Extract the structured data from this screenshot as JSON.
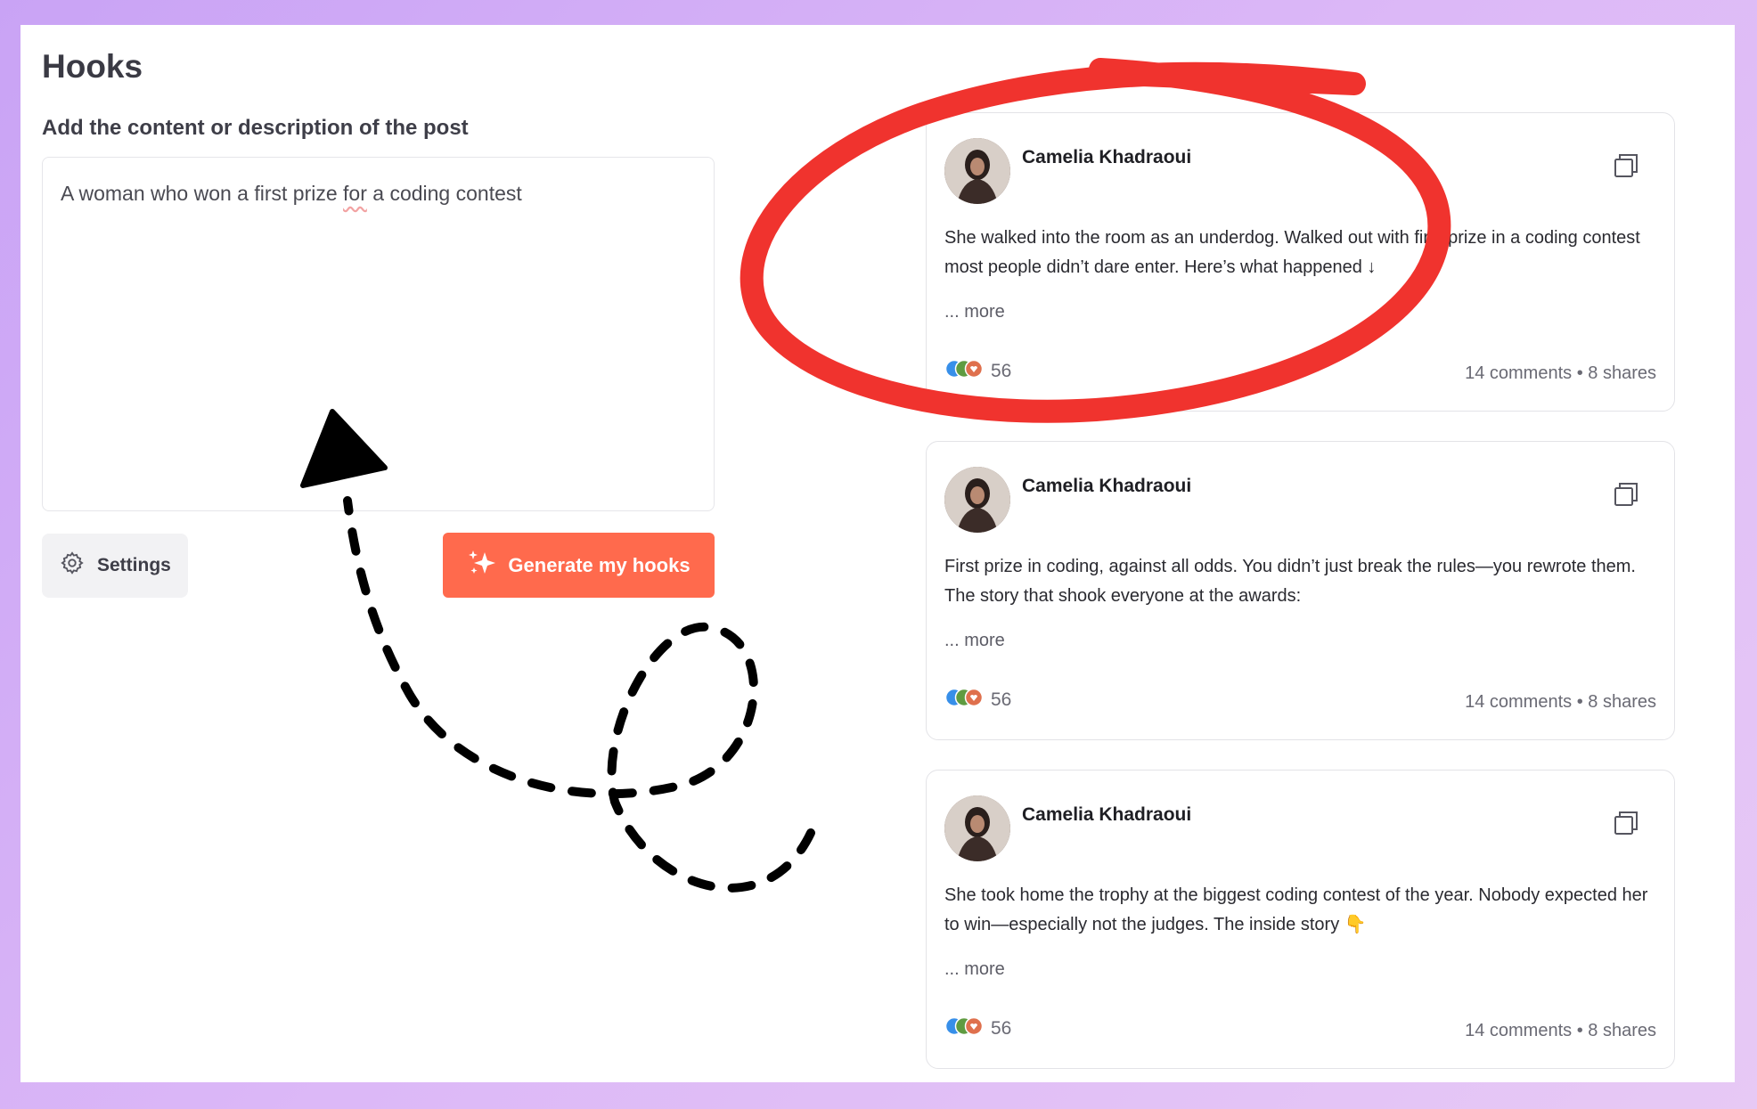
{
  "page": {
    "title": "Hooks",
    "content_label": "Add the content or description of the post",
    "content_value_before": "A woman who won a first prize ",
    "content_value_flagged": "for",
    "content_value_after": " a coding contest"
  },
  "actions": {
    "settings_label": "Settings",
    "generate_label": "Generate my hooks"
  },
  "posts": [
    {
      "author": "Camelia Khadraoui",
      "text": "She walked into the room as an underdog. Walked out with first prize in a coding contest most people didn’t dare enter. Here’s what happened ↓",
      "more": "... more",
      "reactions": "56",
      "comments": "14 comments",
      "separator": "•",
      "shares": "8 shares"
    },
    {
      "author": "Camelia Khadraoui",
      "text": "First prize in coding, against all odds. You didn’t just break the rules—you rewrote them. The story that shook everyone at the awards:",
      "more": "... more",
      "reactions": "56",
      "comments": "14 comments",
      "separator": "•",
      "shares": "8 shares"
    },
    {
      "author": "Camelia Khadraoui",
      "text": "She took home the trophy at the biggest coding contest of the year. Nobody expected her to win—especially not the judges. The inside story 👇",
      "more": "... more",
      "reactions": "56",
      "comments": "14 comments",
      "separator": "•",
      "shares": "8 shares"
    }
  ],
  "colors": {
    "accent": "#ff6a4d",
    "annotation_circle": "#f0332e",
    "annotation_arrow": "#000000",
    "background_gradient": [
      "#c9a3f5",
      "#e7c9f5"
    ]
  },
  "icons": {
    "settings": "gear-icon",
    "generate": "sparkles-icon",
    "copy": "copy-icon",
    "reactions": [
      "like-icon",
      "celebrate-icon",
      "love-icon"
    ]
  }
}
